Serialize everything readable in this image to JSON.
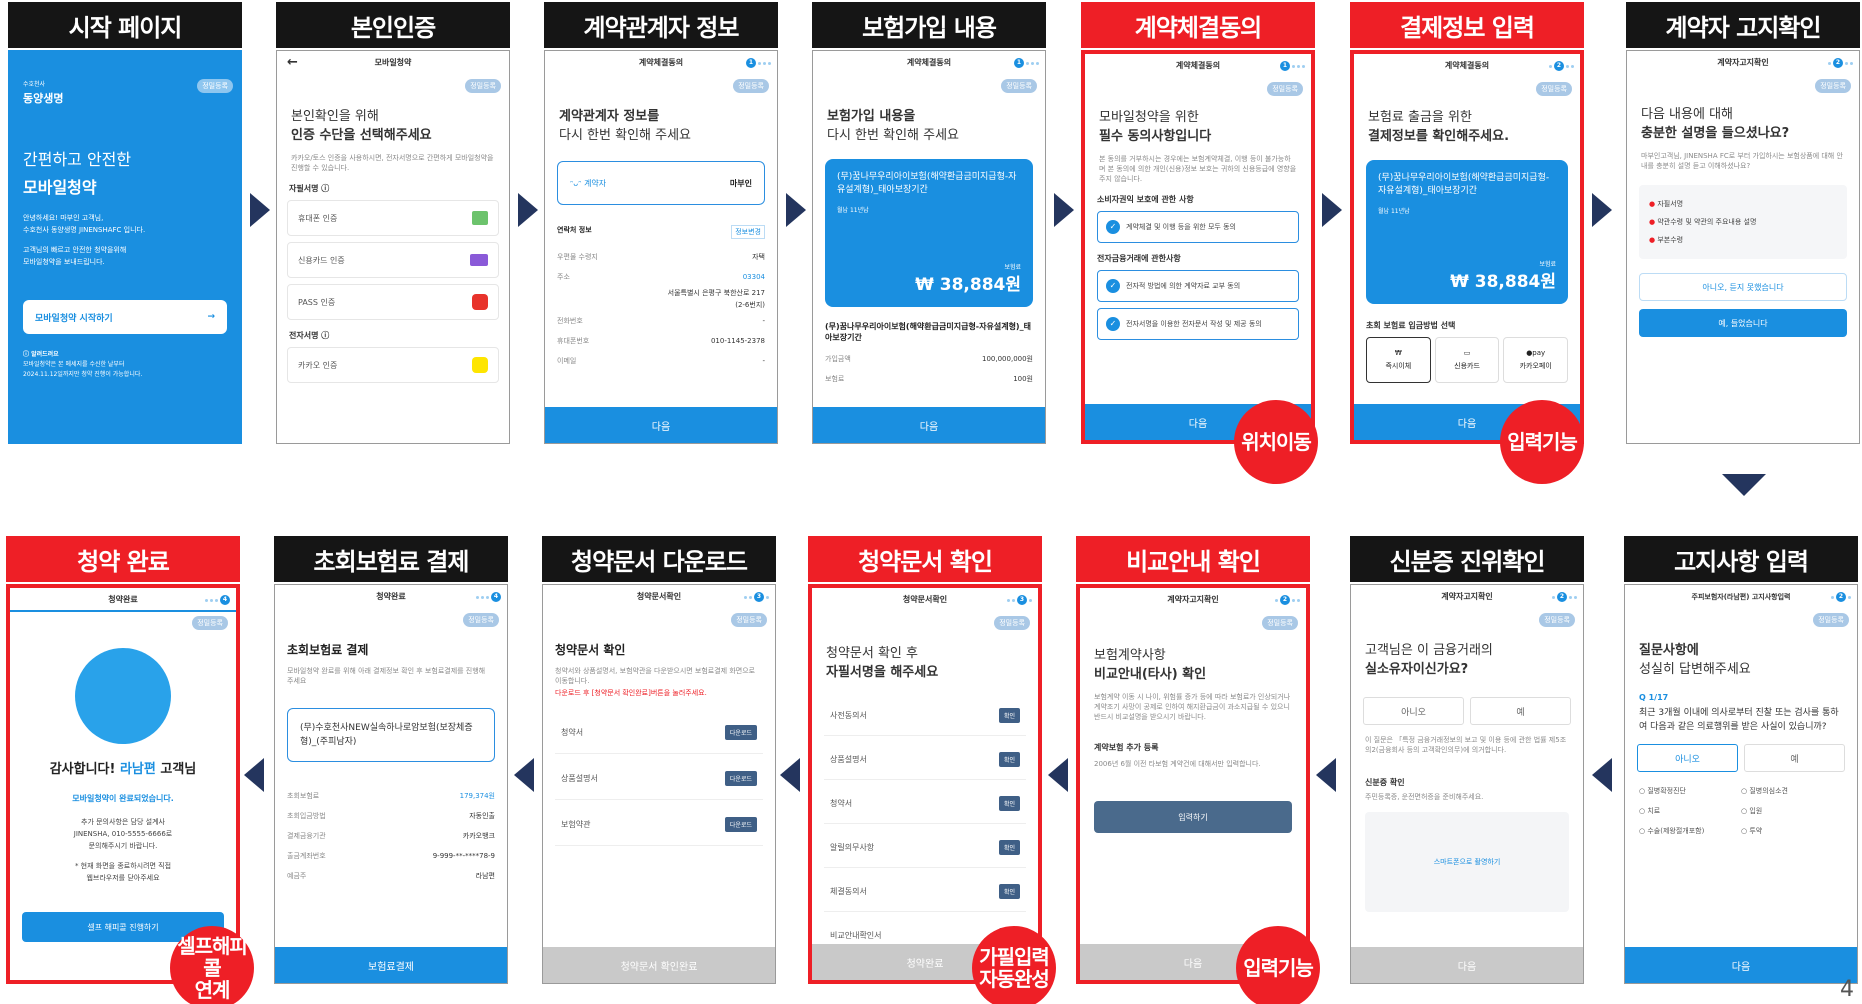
{
  "page_number": "4",
  "steps_row1": [
    {
      "title": "시작 페이지"
    },
    {
      "title": "본인인증"
    },
    {
      "title": "계약관계자 정보"
    },
    {
      "title": "보험가입 내용"
    },
    {
      "title": "계약체결동의"
    },
    {
      "title": "결제정보 입력"
    },
    {
      "title": "계약자 고지확인"
    }
  ],
  "steps_row2": [
    {
      "title": "청약 완료"
    },
    {
      "title": "초회보험료 결제"
    },
    {
      "title": "청약문서 다운로드"
    },
    {
      "title": "청약문서 확인"
    },
    {
      "title": "비교안내 확인"
    },
    {
      "title": "신분증 진위확인"
    },
    {
      "title": "고지사항 입력"
    }
  ],
  "badges": {
    "b1": "위치이동",
    "b2": "입력기능",
    "b3_line1": "셀프해피콜",
    "b3_line2": "연계",
    "b4_line1": "가필입력",
    "b4_line2": "자동완성",
    "b5": "입력기능"
  },
  "s1": {
    "brand_small": "수호천사",
    "brand": "동양생명",
    "tag": "정밀등록",
    "title_a": "간편하고 안전한",
    "title_b": "모바일청약",
    "desc1": "안녕하세요! 마부인 고객님,",
    "desc2": "수호천사 동양생명 JINENSHAFC 입니다.",
    "desc3": "고객님의 빠르고 안전한 청약을위해",
    "desc4": "모바일청약을 보내드립니다.",
    "start": "모바일청약 시작하기",
    "notice_title": "ⓘ 알려드려요",
    "notice1": "모바일청약은 본 메세지를 수신한 날부터",
    "notice2": "2024.11.12일까지만 청약 진행이 가능합니다."
  },
  "s2": {
    "top": "모바일청약",
    "tag": "정밀등록",
    "title_a": "본인확인을 위해",
    "title_b": "인증 수단을 선택해주세요",
    "desc": "카카오/토스 인증을 사용하시면, 전자서명으로 간편하게 모바일청약을 진행할 수 있습니다.",
    "sec1": "자필서명 ⓘ",
    "items": [
      "휴대폰 인증",
      "신용카드 인증",
      "PASS 인증"
    ],
    "sec2": "전자서명 ⓘ",
    "kakao": "카카오 인증"
  },
  "s3": {
    "top": "계약체결동의",
    "tag": "정밀등록",
    "title_a": "계약관계자 정보를",
    "title_b": "다시 한번 확인해 주세요",
    "role": "계약자",
    "name": "마부인",
    "sec": "연락처 정보",
    "edit": "정보변경",
    "kv": [
      {
        "k": "우편물 수령지",
        "v": "자택"
      },
      {
        "k": "주소",
        "v": "03304"
      },
      {
        "k": "",
        "v": "서울특별시 은평구 북한산로 217"
      },
      {
        "k": "",
        "v": "(2-6번지)"
      },
      {
        "k": "전화번호",
        "v": "-"
      },
      {
        "k": "휴대폰번호",
        "v": "010-1145-2378"
      },
      {
        "k": "이메일",
        "v": "-"
      }
    ],
    "next": "다음"
  },
  "s4": {
    "top": "계약체결동의",
    "tag": "정밀등록",
    "title_a": "보험가입 내용을",
    "title_b": "다시 한번 확인해 주세요",
    "product": "(무)꿈나무우리아이보험(해약환급금미지급형-자유설계형)_태아보장기간",
    "chips": "월납   11년납",
    "label": "보험료",
    "amount": "₩ 38,884원",
    "product2": "(무)꿈나무우리아이보험(해약환급금미지급형-자유설계형)_태아보장기간",
    "kv": [
      {
        "k": "가입금액",
        "v": "100,000,000원"
      },
      {
        "k": "보험료",
        "v": "100원"
      }
    ],
    "next": "다음"
  },
  "s5": {
    "top": "계약체결동의",
    "tag": "정밀등록",
    "title_a": "모바일청약을 위한",
    "title_b": "필수 동의사항입니다",
    "desc": "본 동의를 거부하시는 경우에는 보험계약체결, 이행 등이 불가능하며 본 동의에 의한 개인(신용)정보 보호는 귀하의 신용등급에 영향을 주지 않습니다.",
    "sec1": "소비자권익 보호에 관한 사항",
    "c1": "계약체결 및 이행 등을 위한 모두 동의",
    "sec2": "전자금융거래에 관한사항",
    "c2": "전자적 방법에 의한 계약자료 교부 동의",
    "c3": "전자서명을 이용한 전자문서 작성 및 제공 동의",
    "next": "다음"
  },
  "s6": {
    "top": "계약체결동의",
    "tag": "정밀등록",
    "title_a": "보험료 출금을 위한",
    "title_b": "결제정보를 확인해주세요.",
    "product": "(무)꿈나무우리아이보험(해약환급금미지급형-자유설계형)_태아보장기간",
    "chips": "월납   11년납",
    "label": "보험료",
    "amount": "₩ 38,884원",
    "sec": "초회 보험료 입금방법 선택",
    "pay": [
      "즉시이체",
      "신용카드",
      "카카오페이"
    ],
    "next": "다음"
  },
  "s7": {
    "top": "계약자고지확인",
    "tag": "정밀등록",
    "title_a": "다음 내용에 대해",
    "title_b": "충분한 설명을 들으셨나요?",
    "desc": "마부인고객님, JINENSHA FC로 부터 가입하시는 보험상품에 대해 안내를 충분히 설명 듣고 이해하셨나요?",
    "items": [
      "자필서명",
      "약관수령 및 약관의 주요내용 설명",
      "부본수령"
    ],
    "no": "아니오, 듣지 못했습니다",
    "yes": "예, 들었습니다"
  },
  "r1": {
    "top": "청약완료",
    "tag": "정밀등록",
    "thanks_a": "감사합니다!",
    "thanks_name": "라남편",
    "thanks_b": "고객님",
    "done": "모바일청약이 완료되었습니다.",
    "l1": "추가 문의사항은 담당 설계사",
    "l2": "JINENSHA, 010-5555-6666로",
    "l3": "문의해주시기 바랍니다.",
    "l4": "* 현재 화면을 종료하시려면 직접",
    "l5": "웹브라우저를 닫아주세요",
    "btn": "셀프 해피콜 진행하기"
  },
  "r2": {
    "top": "청약완료",
    "tag": "정밀등록",
    "title": "초회보험료 결제",
    "desc": "모바일청약 완료를 위해 아래 결제정보 확인 후 보험료결제를 진행해 주세요",
    "product": "(무)수호천사NEW실속하나로암보험(보장체증형)_(주피남자)",
    "kv": [
      {
        "k": "초회보험료",
        "v": "179,374원"
      },
      {
        "k": "초회입금방법",
        "v": "자동인출"
      },
      {
        "k": "결제금융기관",
        "v": "카카오뱅크"
      },
      {
        "k": "출금계좌번호",
        "v": "9-999-**-****78-9"
      },
      {
        "k": "예금주",
        "v": "라남편"
      }
    ],
    "btn": "보험료결제"
  },
  "r3": {
    "top": "청약문서확인",
    "tag": "정밀등록",
    "title": "청약문서 확인",
    "desc": "청약서와 상품설명서, 보험약관을 다운받으시면 보험료결제 화면으로 이동합니다.",
    "warn": "다운로드 후 [청약문서 확인완료]버튼을 눌러주세요.",
    "docs": [
      "청약서",
      "상품설명서",
      "보험약관"
    ],
    "dl": "다운로드",
    "btn": "청약문서 확인완료"
  },
  "r4": {
    "top": "청약문서확인",
    "tag": "정밀등록",
    "title_a": "청약문서 확인 후",
    "title_b": "자필서명을 해주세요",
    "docs": [
      "사전동의서",
      "상품설명서",
      "청약서",
      "알릴의무사항",
      "체결동의서",
      "비교안내확인서"
    ],
    "ok": "확인",
    "btn": "청약완료"
  },
  "r5": {
    "top": "계약자고지확인",
    "tag": "정밀등록",
    "title_a": "보험계약사항",
    "title_b": "비교안내(타사) 확인",
    "desc": "보험계약 이동 시 나이, 위험률 증가 등에 따라 보험료가 인상되거나 계약조기 사망이 공제로 인하여 해지환급금이 과소지급될 수 있으니 반드시 비교설명을 받으시기 바랍니다.",
    "sec": "계약보험 추가 등록",
    "sec_desc": "2006년 6월 이전 타보험 계약건에 대해서만 입력합니다.",
    "btn_input": "입력하기",
    "next": "다음"
  },
  "r6": {
    "top": "계약자고지확인",
    "tag": "정밀등록",
    "title_a": "고객님은 이 금융거래의",
    "title_b": "실소유자이신가요?",
    "no": "아니오",
    "yes": "예",
    "desc": "이 질문은 「특정 금융거래정보의 보고 및 이용 등에 관한 법률 제5조의2(금융회사 등의 고객확인의무)에 의거합니다.",
    "sec": "신분증 확인",
    "sec_desc": "주민등록증, 운전면허증을 준비해주세요.",
    "photo": "스마트폰으로 촬영하기",
    "next": "다음"
  },
  "r7": {
    "top": "주피보험자(라남편) 고지사항입력",
    "tag": "정밀등록",
    "title_a": "질문사항에",
    "title_b": "성실히 답변해주세요",
    "q": "Q 1/17",
    "question": "최근 3개월 이내에 의사로부터 진찰 또는 검사를 통하여 다음과 같은 의료행위를 받은 사실이 있습니까?",
    "no": "아니오",
    "yes": "예",
    "opts": [
      "질병확정진단",
      "질병의심소견",
      "치료",
      "입원",
      "수술(제왕절개포함)",
      "투약"
    ],
    "next": "다음"
  }
}
